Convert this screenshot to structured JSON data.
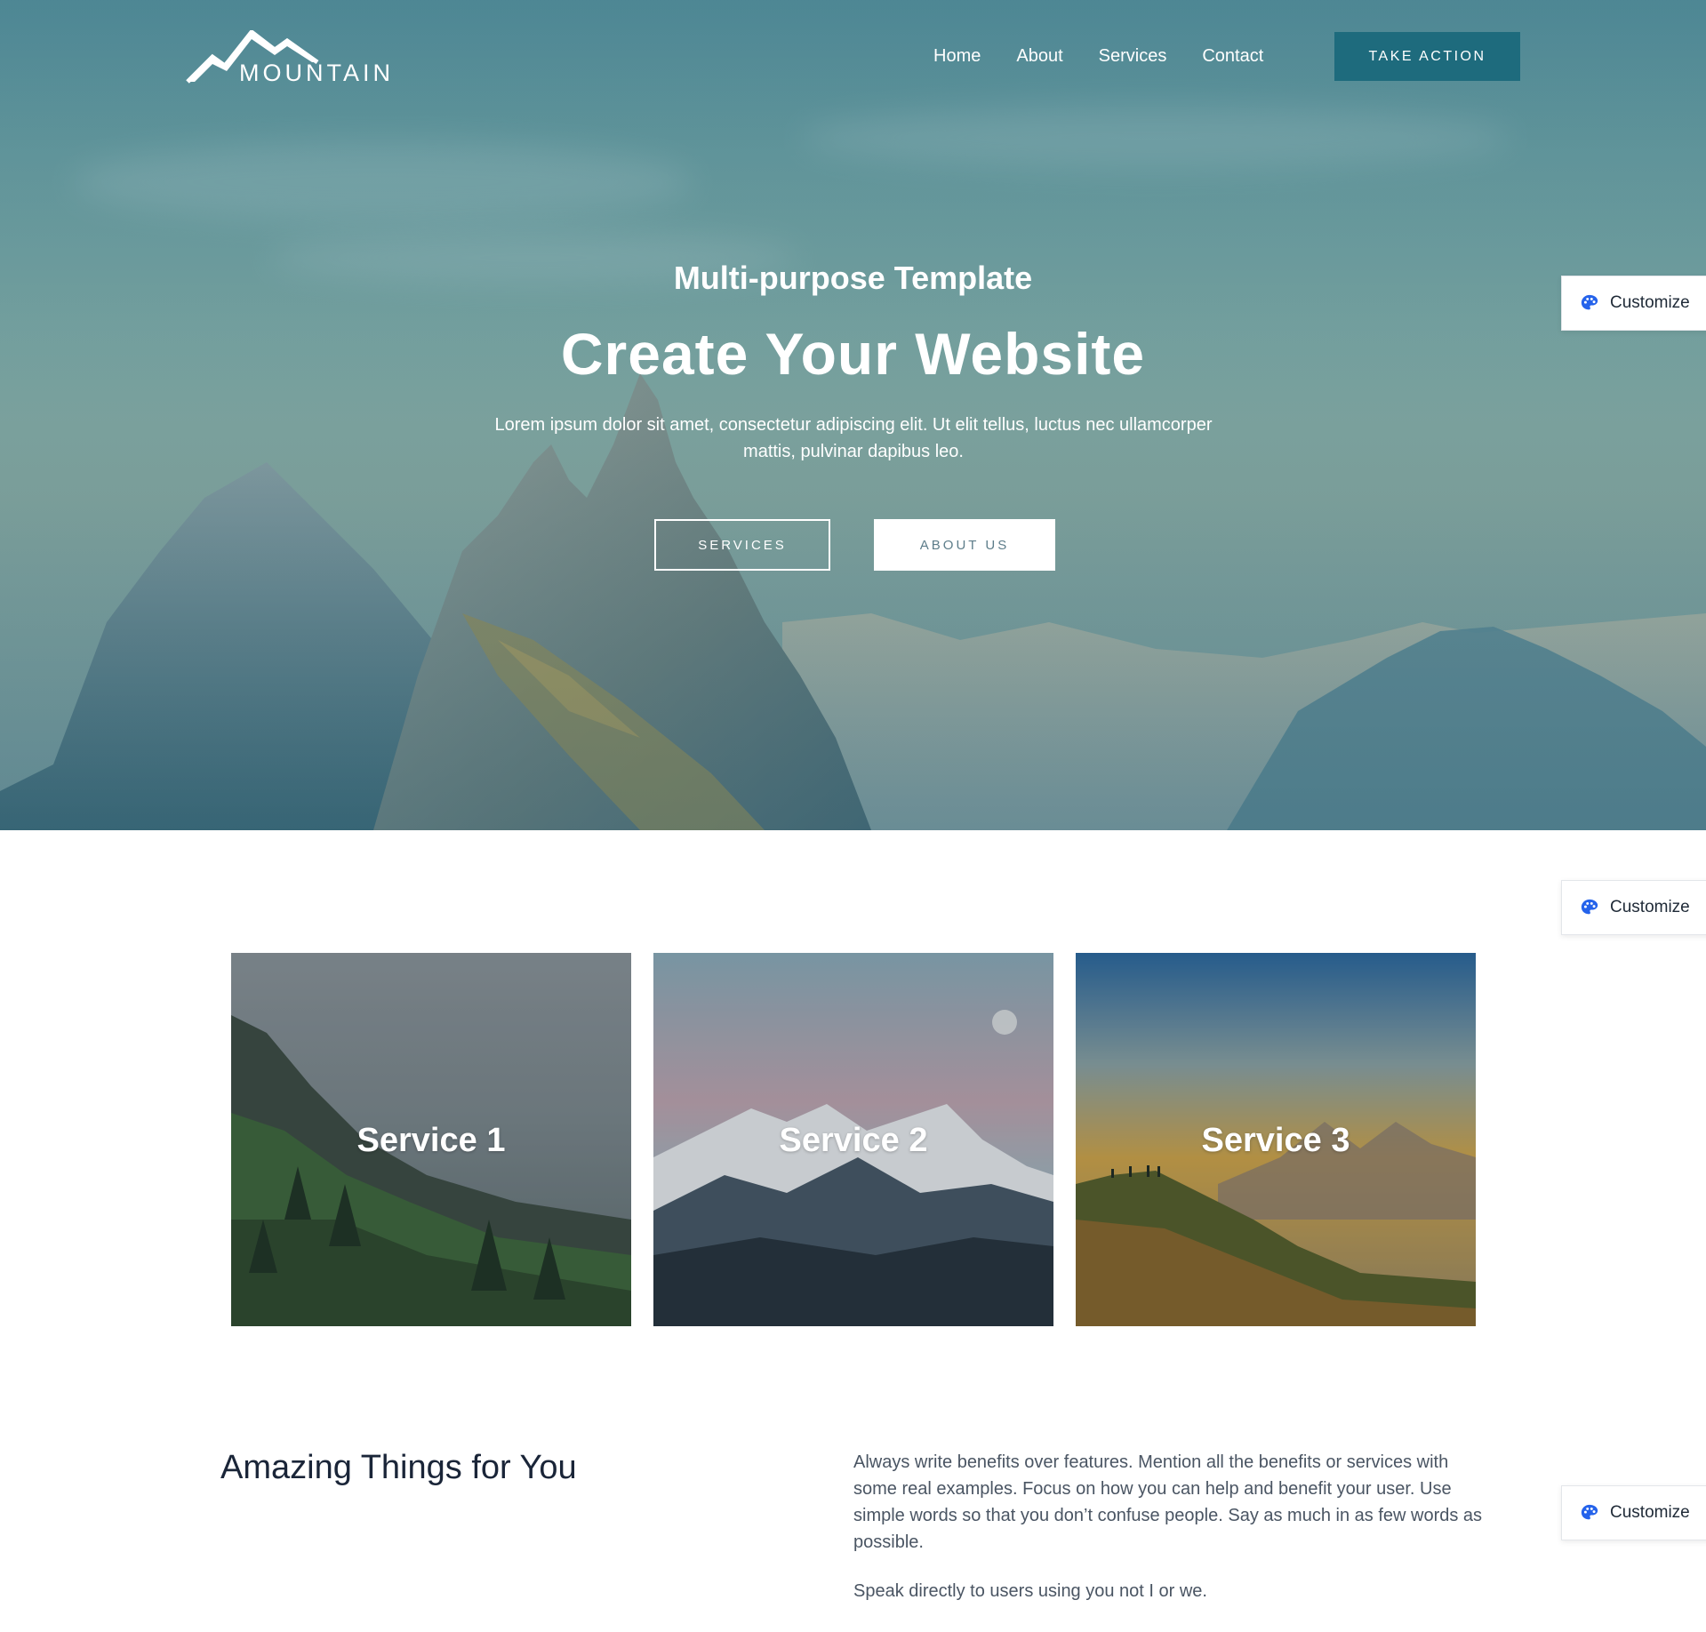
{
  "logo": {
    "text": "MOUNTAIN"
  },
  "nav": {
    "items": [
      "Home",
      "About",
      "Services",
      "Contact"
    ],
    "cta_label": "TAKE ACTION"
  },
  "hero": {
    "subtitle": "Multi-purpose Template",
    "title": "Create Your Website",
    "text": "Lorem ipsum dolor sit amet, consectetur adipiscing elit. Ut elit tellus, luctus nec ullamcorper mattis, pulvinar dapibus leo.",
    "services_button": "SERVICES",
    "about_button": "ABOUT US"
  },
  "customize": {
    "label": "Customize",
    "icon": "palette-icon"
  },
  "services": [
    {
      "label": "Service 1"
    },
    {
      "label": "Service 2"
    },
    {
      "label": "Service 3"
    }
  ],
  "about": {
    "heading": "Amazing Things for You",
    "paragraph_1": "Always write benefits over features. Mention all the benefits or services with some real examples. Focus on how you can help and benefit your user. Use simple words so that you don’t confuse people. Say as much in as few words as possible.",
    "paragraph_2": "Speak directly to users using you not I or we."
  },
  "colors": {
    "accent": "#1e6b7d",
    "heading": "#1a2538",
    "body_text": "#4a5563",
    "palette_icon": "#2563eb"
  }
}
